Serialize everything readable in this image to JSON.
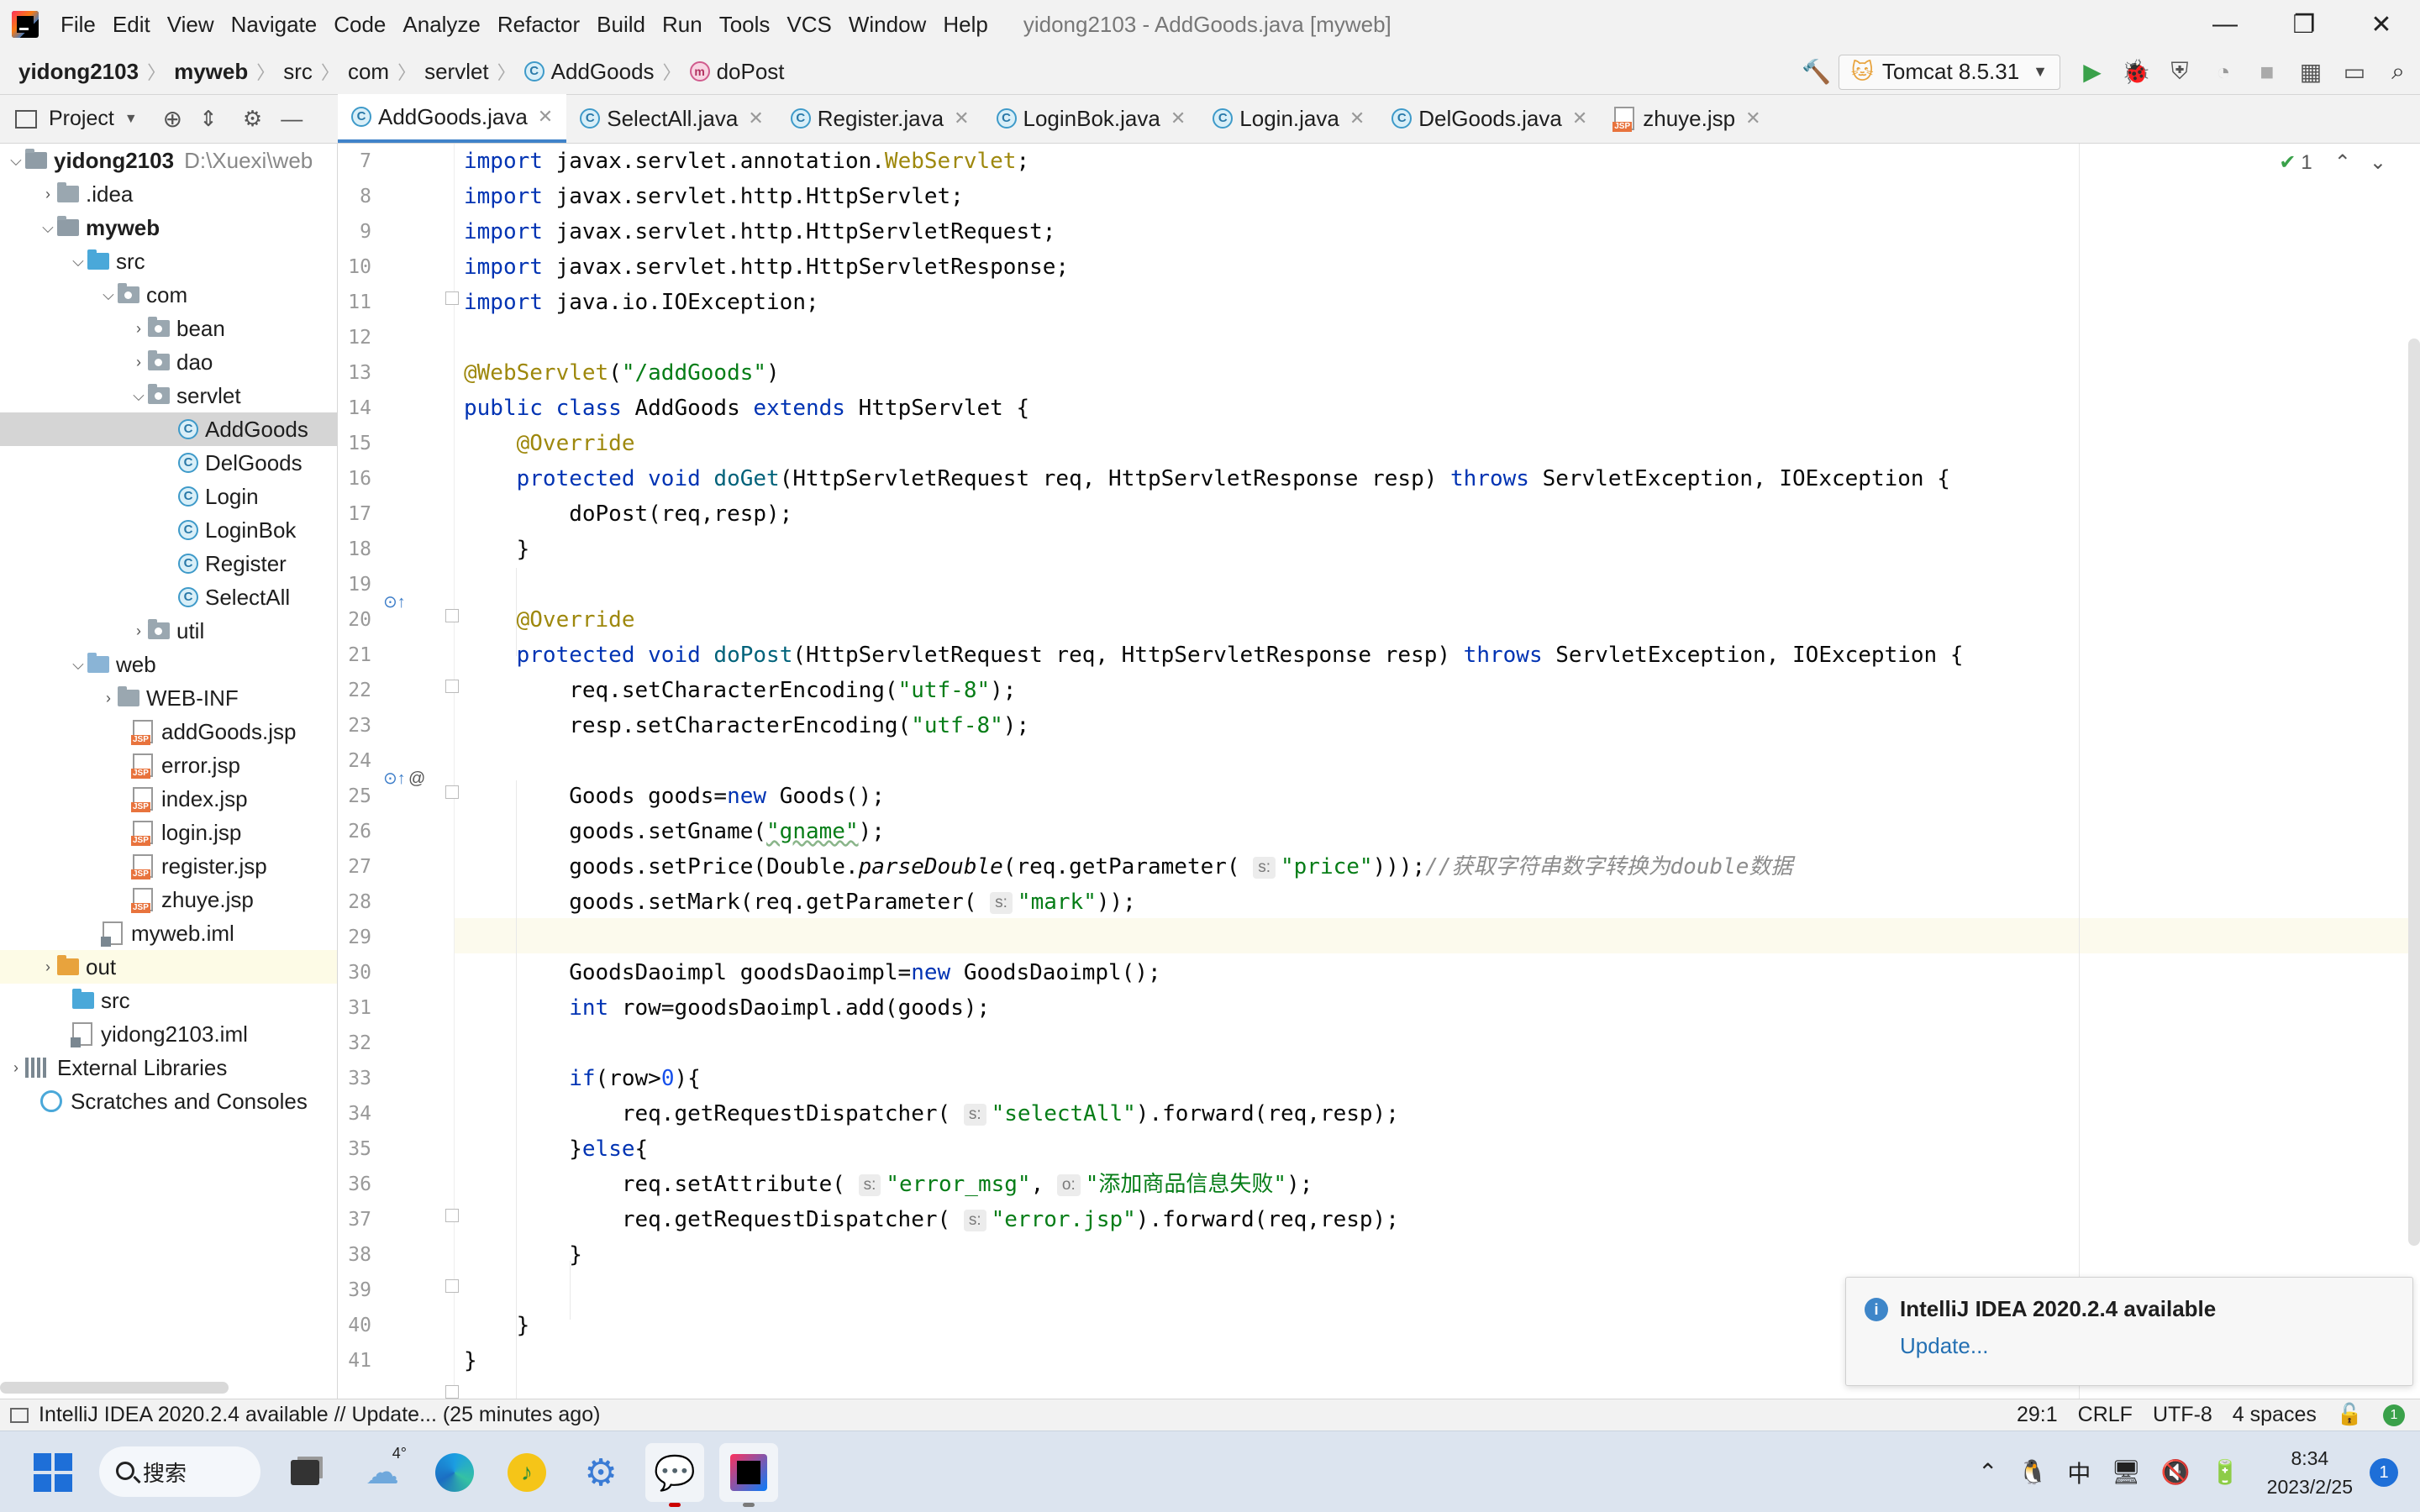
{
  "window": {
    "title": "yidong2103 - AddGoods.java [myweb]",
    "controls": {
      "minimize": "—",
      "restore": "❐",
      "close": "✕"
    }
  },
  "menu": [
    "File",
    "Edit",
    "View",
    "Navigate",
    "Code",
    "Analyze",
    "Refactor",
    "Build",
    "Run",
    "Tools",
    "VCS",
    "Window",
    "Help"
  ],
  "breadcrumb": [
    "yidong2103",
    "myweb",
    "src",
    "com",
    "servlet",
    "AddGoods",
    "doPost"
  ],
  "toolbar": {
    "run_config": "Tomcat 8.5.31"
  },
  "project_panel": {
    "title": "Project",
    "root_path": "D:\\Xuexi\\web",
    "tree": [
      {
        "label": "yidong2103",
        "arrow": "v",
        "icon": "module-folder",
        "bold": true
      },
      {
        "label": ".idea",
        "arrow": ">",
        "icon": "folder"
      },
      {
        "label": "myweb",
        "arrow": "v",
        "icon": "module-folder",
        "bold": true
      },
      {
        "label": "src",
        "arrow": "v",
        "icon": "source-folder"
      },
      {
        "label": "com",
        "arrow": "v",
        "icon": "package"
      },
      {
        "label": "bean",
        "arrow": ">",
        "icon": "package"
      },
      {
        "label": "dao",
        "arrow": ">",
        "icon": "package"
      },
      {
        "label": "servlet",
        "arrow": "v",
        "icon": "package"
      },
      {
        "label": "AddGoods",
        "arrow": "",
        "icon": "class",
        "selected": true
      },
      {
        "label": "DelGoods",
        "arrow": "",
        "icon": "class"
      },
      {
        "label": "Login",
        "arrow": "",
        "icon": "class"
      },
      {
        "label": "LoginBok",
        "arrow": "",
        "icon": "class"
      },
      {
        "label": "Register",
        "arrow": "",
        "icon": "class"
      },
      {
        "label": "SelectAll",
        "arrow": "",
        "icon": "class"
      },
      {
        "label": "util",
        "arrow": ">",
        "icon": "package"
      },
      {
        "label": "web",
        "arrow": "v",
        "icon": "web-folder"
      },
      {
        "label": "WEB-INF",
        "arrow": ">",
        "icon": "folder"
      },
      {
        "label": "addGoods.jsp",
        "arrow": "",
        "icon": "jsp"
      },
      {
        "label": "error.jsp",
        "arrow": "",
        "icon": "jsp"
      },
      {
        "label": "index.jsp",
        "arrow": "",
        "icon": "jsp"
      },
      {
        "label": "login.jsp",
        "arrow": "",
        "icon": "jsp"
      },
      {
        "label": "register.jsp",
        "arrow": "",
        "icon": "jsp"
      },
      {
        "label": "zhuye.jsp",
        "arrow": "",
        "icon": "jsp"
      },
      {
        "label": "myweb.iml",
        "arrow": "",
        "icon": "iml"
      },
      {
        "label": "out",
        "arrow": ">",
        "icon": "out-folder"
      },
      {
        "label": "src",
        "arrow": "",
        "icon": "source-folder"
      },
      {
        "label": "yidong2103.iml",
        "arrow": "",
        "icon": "iml"
      },
      {
        "label": "External Libraries",
        "arrow": ">",
        "icon": "library"
      },
      {
        "label": "Scratches and Consoles",
        "arrow": "",
        "icon": "scratches"
      }
    ]
  },
  "tabs": [
    {
      "label": "AddGoods.java",
      "icon": "class",
      "active": true
    },
    {
      "label": "SelectAll.java",
      "icon": "class"
    },
    {
      "label": "Register.java",
      "icon": "class"
    },
    {
      "label": "LoginBok.java",
      "icon": "class"
    },
    {
      "label": "Login.java",
      "icon": "class"
    },
    {
      "label": "DelGoods.java",
      "icon": "class"
    },
    {
      "label": "zhuye.jsp",
      "icon": "jsp"
    }
  ],
  "editor": {
    "first_line": 7,
    "inspection_count": "1",
    "line_numbers": [
      "7",
      "8",
      "9",
      "10",
      "11",
      "12",
      "13",
      "14",
      "15",
      "16",
      "17",
      "18",
      "19",
      "20",
      "21",
      "22",
      "23",
      "24",
      "25",
      "26",
      "27",
      "28",
      "29",
      "30",
      "31",
      "32",
      "33",
      "34",
      "35",
      "36",
      "37",
      "38",
      "39",
      "40",
      "41"
    ],
    "code": {
      "l7_a": "import ",
      "l7_b": "javax.servlet.annotation.",
      "l7_c": "WebServlet",
      "l7_d": ";",
      "l8_a": "import ",
      "l8_b": "javax.servlet.http.HttpServlet;",
      "l9_a": "import ",
      "l9_b": "javax.servlet.http.HttpServletRequest;",
      "l10_a": "import ",
      "l10_b": "javax.servlet.http.HttpServletResponse;",
      "l11_a": "import ",
      "l11_b": "java.io.IOException;",
      "l13_a": "@WebServlet",
      "l13_b": "(",
      "l13_c": "\"/addGoods\"",
      "l13_d": ")",
      "l14_a": "public class ",
      "l14_b": "AddGoods ",
      "l14_c": "extends ",
      "l14_d": "HttpServlet {",
      "l15_a": "    @Override",
      "l16_a": "    protected void ",
      "l16_b": "doGet",
      "l16_c": "(HttpServletRequest req, HttpServletResponse resp) ",
      "l16_d": "throws ",
      "l16_e": "ServletException, IOException {",
      "l17_a": "        doPost(req,resp);",
      "l18_a": "    }",
      "l20_a": "    @Override",
      "l21_a": "    protected void ",
      "l21_b": "doPost",
      "l21_c": "(HttpServletRequest req, HttpServletResponse resp) ",
      "l21_d": "throws ",
      "l21_e": "ServletException, IOException {",
      "l22_a": "        req.setCharacterEncoding(",
      "l22_b": "\"utf-8\"",
      "l22_c": ");",
      "l23_a": "        resp.setCharacterEncoding(",
      "l23_b": "\"utf-8\"",
      "l23_c": ");",
      "l25_a": "        Goods goods=",
      "l25_b": "new ",
      "l25_c": "Goods();",
      "l26_a": "        goods.setGname(",
      "l26_b": "\"gname\"",
      "l26_c": ");",
      "l27_a": "        goods.setPrice(Double.",
      "l27_b": "parseDouble",
      "l27_c": "(req.getParameter( ",
      "l27_hint": "s:",
      "l27_d": "\"price\"",
      "l27_e": ")));",
      "l27_f": "//获取字符串数字转换为double数据",
      "l28_a": "        goods.setMark(req.getParameter( ",
      "l28_hint": "s:",
      "l28_b": "\"mark\"",
      "l28_c": "));",
      "l30_a": "        GoodsDaoimpl goodsDaoimpl=",
      "l30_b": "new ",
      "l30_c": "GoodsDaoimpl();",
      "l31_a": "        ",
      "l31_b": "int ",
      "l31_c": "row=goodsDaoimpl.add(goods);",
      "l33_a": "        ",
      "l33_b": "if",
      "l33_c": "(row>",
      "l33_d": "0",
      "l33_e": "){",
      "l34_a": "            req.getRequestDispatcher( ",
      "l34_hint": "s:",
      "l34_b": "\"selectAll\"",
      "l34_c": ").forward(req,resp);",
      "l35_a": "        }",
      "l35_b": "else",
      "l35_c": "{",
      "l36_a": "            req.setAttribute( ",
      "l36_hint": "s:",
      "l36_b": "\"error_msg\"",
      "l36_c": ", ",
      "l36_hint2": "o:",
      "l36_d": "\"添加商品信息失败\"",
      "l36_e": ");",
      "l37_a": "            req.getRequestDispatcher( ",
      "l37_hint": "s:",
      "l37_b": "\"error.jsp\"",
      "l37_c": ").forward(req,resp);",
      "l38_a": "        }",
      "l40_a": "    }",
      "l41_a": "}"
    }
  },
  "notification": {
    "title": "IntelliJ IDEA 2020.2.4 available",
    "link": "Update..."
  },
  "statusbar": {
    "message": "IntelliJ IDEA 2020.2.4 available // Update... (25 minutes ago)",
    "position": "29:1",
    "line_separator": "CRLF",
    "encoding": "UTF-8",
    "indent": "4 spaces"
  },
  "taskbar": {
    "search_label": "搜索",
    "weather_temp": "4°",
    "ime": "中",
    "time": "8:34",
    "date": "2023/2/25",
    "notification_count": "1"
  },
  "colors": {
    "accent": "#4083c9",
    "keyword": "#0033b3",
    "string": "#067d17",
    "annotation": "#9e880d",
    "comment": "#8c8c8c"
  }
}
